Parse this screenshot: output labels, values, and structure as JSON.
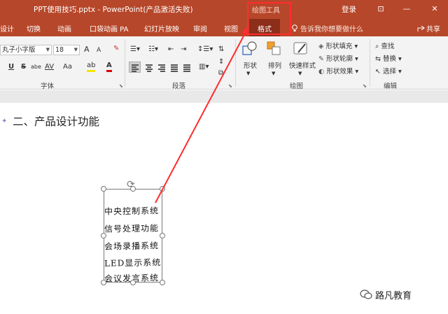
{
  "titlebar": {
    "title": "PPT使用技巧.pptx  -  PowerPoint(产品激活失败)",
    "context_label": "绘图工具",
    "login": "登录",
    "restore_glyph": "⊡",
    "minimize_glyph": "—",
    "close_glyph": "✕"
  },
  "tabs": {
    "design": "设计",
    "transitions": "切换",
    "animations": "动画",
    "pocket": "口袋动画 PA",
    "slideshow": "幻灯片放映",
    "review": "审阅",
    "view": "视图",
    "format": "格式",
    "tellme": "告诉我你想要做什么",
    "share": "共享"
  },
  "ribbon": {
    "font_name": "丸子小字版",
    "font_size": "18",
    "grow_font": "A",
    "shrink_font": "A",
    "underline": "U",
    "strike": "S",
    "shadow": "abe",
    "spacing": "AV",
    "case": "Aa",
    "highlight": "ab",
    "font_color": "A",
    "font_group": "字体",
    "paragraph_group": "段落",
    "shape_btn": "形状",
    "arrange_btn": "排列",
    "quickstyle_btn": "快速样式",
    "shape_fill": "形状填充",
    "shape_outline": "形状轮廓",
    "shape_effects": "形状效果",
    "drawing_group": "绘图",
    "find": "查找",
    "replace": "替换",
    "select": "选择",
    "editing_group": "编辑"
  },
  "slide": {
    "heading": "二、产品设计功能",
    "textbox_lines": [
      "中央控制系统",
      "信号处理功能",
      "会场录播系统",
      "LED显示系统",
      "会议发言系统"
    ]
  },
  "watermark": {
    "text": "路凡教育"
  },
  "colors": {
    "accent": "#b7472a",
    "annotation": "#ff2d2d"
  }
}
